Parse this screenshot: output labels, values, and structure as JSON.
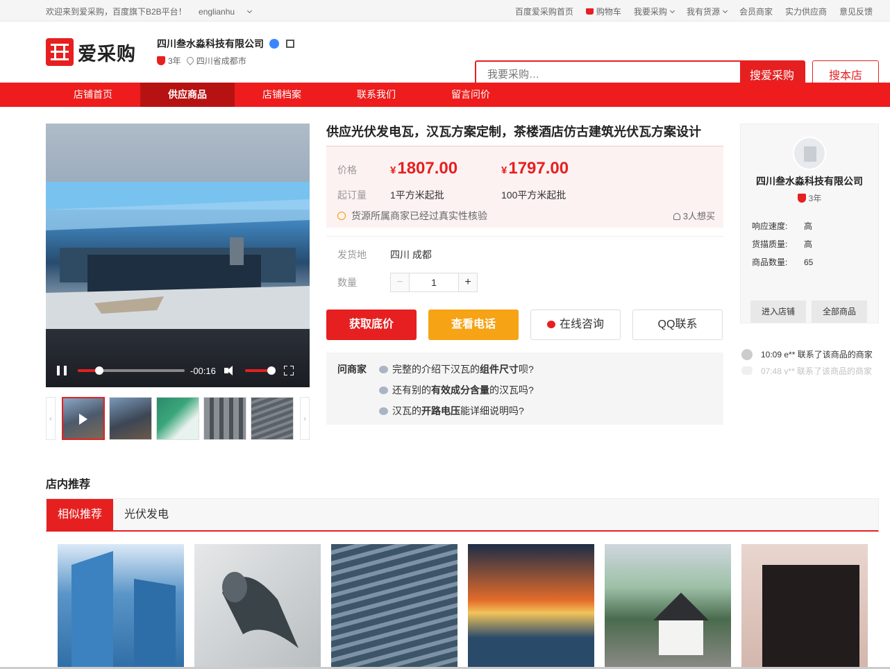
{
  "topbar": {
    "welcome": "欢迎来到爱采购，百度旗下B2B平台！",
    "user": "englianhu",
    "links": [
      "百度爱采购首页",
      "购物车",
      "我要采购",
      "我有货源",
      "会员商家",
      "实力供应商",
      "意见反馈"
    ]
  },
  "header": {
    "logo_text": "爱采购",
    "shop_name": "四川叁水淼科技有限公司",
    "years": "3年",
    "location": "四川省成都市",
    "search_placeholder": "我要采购…",
    "search_button": "搜爱采购",
    "shop_search_button": "搜本店"
  },
  "nav": [
    "店铺首页",
    "供应商品",
    "店铺档案",
    "联系我们",
    "留言问价"
  ],
  "nav_active": "供应商品",
  "video": {
    "time": "-00:16",
    "progress": 0.2,
    "volume": 1.0
  },
  "product": {
    "title": "供应光伏发电瓦，汉瓦方案定制，茶楼酒店仿古建筑光伏瓦方案设计",
    "price_label": "价格",
    "currency": "¥",
    "price1": "1807.00",
    "price2": "1797.00",
    "moq_label": "起订量",
    "moq1": "1平方米起批",
    "moq2": "100平方米起批",
    "verify_text": "货源所属商家已经过真实性核验",
    "wants": "3人想买",
    "ship_label": "发货地",
    "ship_value": "四川 成都",
    "qty_label": "数量",
    "qty_value": "1",
    "qty_minus": "−",
    "qty_plus": "+"
  },
  "actions": {
    "get_price": "获取底价",
    "view_phone": "查看电话",
    "online_consult": "在线咨询",
    "qq": "QQ联系"
  },
  "ask": {
    "heading": "问商家",
    "questions": [
      {
        "pre": "完整的介绍下汉瓦的",
        "bold": "组件尺寸",
        "post": "呗?"
      },
      {
        "pre": "还有别的",
        "bold": "有效成分含量",
        "post": "的汉瓦吗?"
      },
      {
        "pre": "汉瓦的",
        "bold": "开路电压",
        "post": "能详细说明吗?"
      }
    ]
  },
  "sidebar": {
    "name": "四川叁水淼科技有限公司",
    "years": "3年",
    "stats": [
      {
        "k": "响应速度:",
        "v": "高"
      },
      {
        "k": "货描质量:",
        "v": "高"
      },
      {
        "k": "商品数量:",
        "v": "65"
      }
    ],
    "enter_shop": "进入店铺",
    "all_products": "全部商品"
  },
  "feed": [
    "10:09 e** 联系了该商品的商家",
    "07:48 y** 联系了该商品的商家"
  ],
  "recommend": {
    "title": "店内推荐",
    "tabs": [
      "相似推荐",
      "光伏发电"
    ]
  },
  "colors": {
    "brand_red": "#e62020",
    "orange": "#f6a316"
  }
}
